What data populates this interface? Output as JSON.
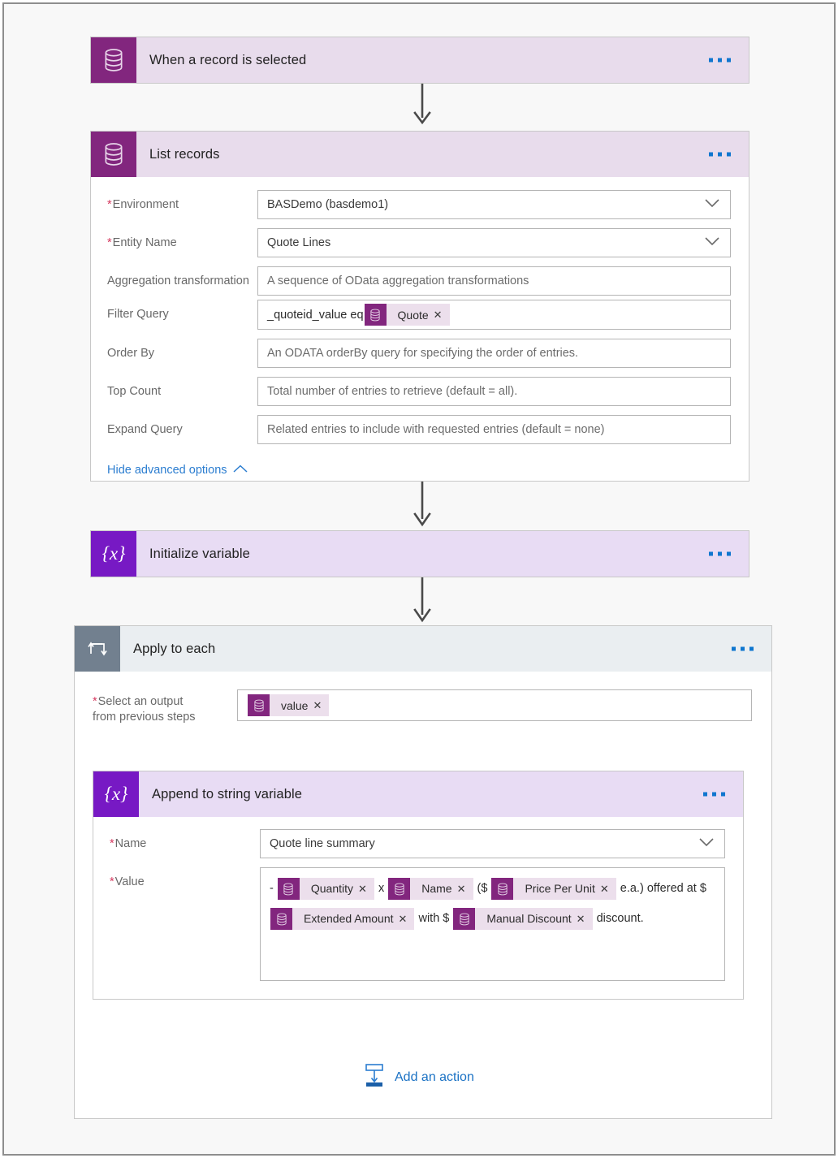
{
  "flow": {
    "nodes": [
      {
        "id": "trigger",
        "title": "When a record is selected",
        "icon": "dataverse-database-icon",
        "menu": "more-options-ellipsis"
      },
      {
        "id": "list-records",
        "title": "List records",
        "icon": "dataverse-database-icon",
        "menu": "more-options-ellipsis",
        "fields": [
          {
            "label": "Environment",
            "required": true,
            "value": "BASDemo (basdemo1)",
            "placeholder": "",
            "control": "dropdown"
          },
          {
            "label": "Entity Name",
            "required": true,
            "value": "Quote Lines",
            "placeholder": "",
            "control": "dropdown"
          },
          {
            "label": "Aggregation transformation",
            "required": false,
            "value": "",
            "placeholder": "A sequence of OData aggregation transformations",
            "control": "text"
          },
          {
            "label": "Filter Query",
            "required": false,
            "value": "_quoteid_value eq",
            "placeholder": "",
            "control": "tokens",
            "tokens": [
              "Quote"
            ]
          },
          {
            "label": "Order By",
            "required": false,
            "value": "",
            "placeholder": "An ODATA orderBy query for specifying the order of entries.",
            "control": "text"
          },
          {
            "label": "Top Count",
            "required": false,
            "value": "",
            "placeholder": "Total number of entries to retrieve (default = all).",
            "control": "text"
          },
          {
            "label": "Expand Query",
            "required": false,
            "value": "",
            "placeholder": "Related entries to include with requested entries (default = none)",
            "control": "text"
          }
        ],
        "advanced_link": "Hide advanced options"
      },
      {
        "id": "initialize-variable",
        "title": "Initialize variable",
        "icon": "variable-braces-icon",
        "menu": "more-options-ellipsis"
      },
      {
        "id": "apply-to-each",
        "title": "Apply to each",
        "icon": "loop-repeat-icon",
        "menu": "more-options-ellipsis",
        "output_label_line1": "Select an output",
        "output_label_line2": "from previous steps",
        "output_token": "value",
        "add_action_label": "Add an action",
        "add_action_icon": "insert-action-icon"
      },
      {
        "id": "append-to-string-variable",
        "title": "Append to string variable",
        "icon": "variable-braces-icon",
        "menu": "more-options-ellipsis",
        "name_label": "Name",
        "name_value": "Quote line summary",
        "value_label": "Value",
        "value_segments": [
          {
            "type": "text",
            "text": "-"
          },
          {
            "type": "token",
            "text": "Quantity"
          },
          {
            "type": "text",
            "text": "x"
          },
          {
            "type": "token",
            "text": "Name"
          },
          {
            "type": "text",
            "text": "($"
          },
          {
            "type": "token",
            "text": "Price Per Unit"
          },
          {
            "type": "text",
            "text": "e.a.)"
          },
          {
            "type": "text",
            "text": "offered at $"
          },
          {
            "type": "token",
            "text": "Extended Amount"
          },
          {
            "type": "text",
            "text": "with $"
          },
          {
            "type": "token",
            "text": "Manual Discount"
          },
          {
            "type": "text",
            "text": "discount."
          }
        ]
      }
    ]
  },
  "colors": {
    "dataverse_purple": "#82267e",
    "variable_violet": "#7719c4",
    "loop_slate": "#72808f",
    "header_lavender": "#e8dcec",
    "loop_header": "#eaeef1",
    "token_fill": "#ecdfec",
    "link_blue": "#2b7dd0",
    "required_red": "#d5395f",
    "canvas": "#f8f8f8"
  }
}
